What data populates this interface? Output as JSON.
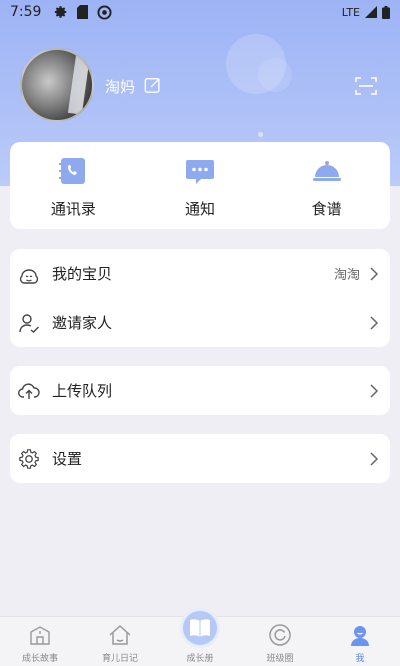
{
  "status_bar": {
    "time": "7:59",
    "network": "LTE"
  },
  "profile": {
    "name": "淘妈"
  },
  "quick_actions": [
    {
      "label": "通讯录",
      "icon": "address-book-icon"
    },
    {
      "label": "通知",
      "icon": "notification-icon"
    },
    {
      "label": "食谱",
      "icon": "recipe-cloche-icon"
    }
  ],
  "menu_group1": [
    {
      "label": "我的宝贝",
      "value": "淘淘",
      "icon": "baby-icon"
    },
    {
      "label": "邀请家人",
      "value": "",
      "icon": "invite-user-icon"
    }
  ],
  "menu_group2": [
    {
      "label": "上传队列",
      "icon": "cloud-upload-icon"
    }
  ],
  "menu_group3": [
    {
      "label": "设置",
      "icon": "settings-gear-icon"
    }
  ],
  "bottom_nav": [
    {
      "label": "成长故事",
      "icon": "story-icon"
    },
    {
      "label": "育儿日记",
      "icon": "home-icon"
    },
    {
      "label": "成长册",
      "icon": "book-icon"
    },
    {
      "label": "班级圈",
      "icon": "circle-icon"
    },
    {
      "label": "我",
      "icon": "me-icon",
      "active": true
    }
  ],
  "colors": {
    "accent": "#5c86e8",
    "header": "#9db3f5",
    "icon_blue": "#8fa9ee"
  }
}
